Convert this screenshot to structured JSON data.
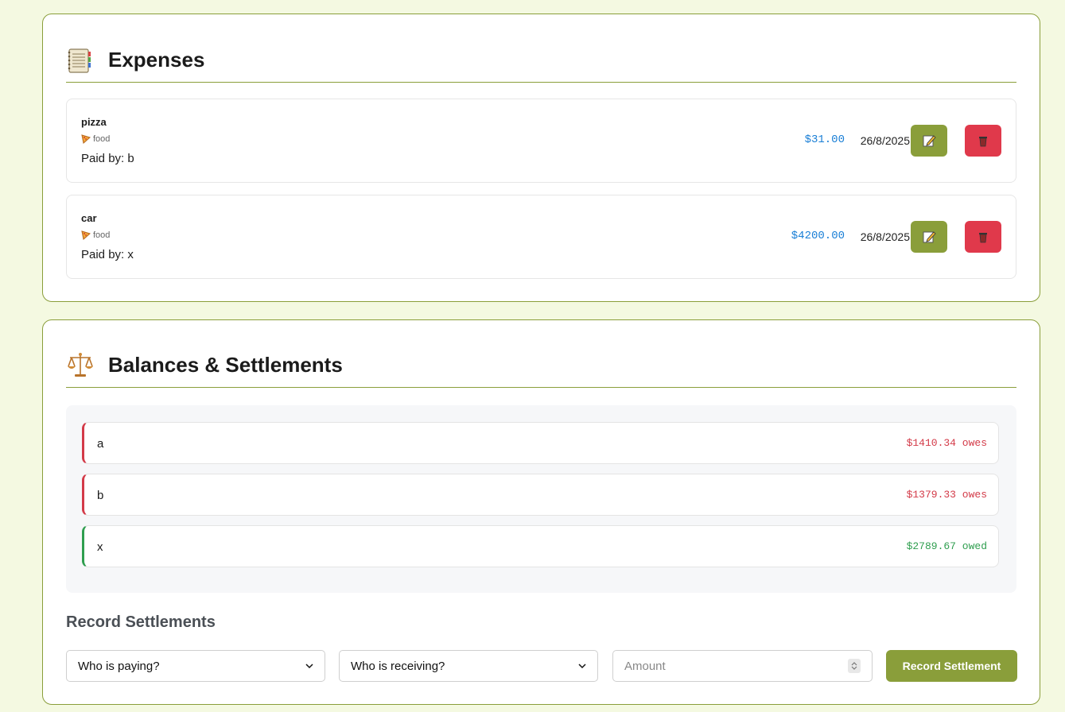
{
  "expenses": {
    "title": "Expenses",
    "icon": "ledger-icon",
    "items": [
      {
        "name": "pizza",
        "category": "food",
        "paid_by": "Paid by: b",
        "amount": "$31.00",
        "date": "26/8/2025",
        "edit_icon": "edit-icon",
        "delete_icon": "trash-icon"
      },
      {
        "name": "car",
        "category": "food",
        "paid_by": "Paid by: x",
        "amount": "$4200.00",
        "date": "26/8/2025",
        "edit_icon": "edit-icon",
        "delete_icon": "trash-icon"
      }
    ]
  },
  "balances": {
    "title": "Balances & Settlements",
    "icon": "scales-icon",
    "rows": [
      {
        "name": "a",
        "amount": "$1410.34 owes",
        "status": "owes"
      },
      {
        "name": "b",
        "amount": "$1379.33 owes",
        "status": "owes"
      },
      {
        "name": "x",
        "amount": "$2789.67 owed",
        "status": "owed"
      }
    ]
  },
  "settlement": {
    "title": "Record Settlements",
    "payer_placeholder": "Who is paying?",
    "receiver_placeholder": "Who is receiving?",
    "amount_placeholder": "Amount",
    "button_label": "Record Settlement"
  },
  "colors": {
    "accent": "#8a9e3a",
    "danger": "#e0394b",
    "owes": "#d33a48",
    "owed": "#2f9e4f",
    "amount": "#1a7fd6",
    "background": "#f4f9e1"
  }
}
